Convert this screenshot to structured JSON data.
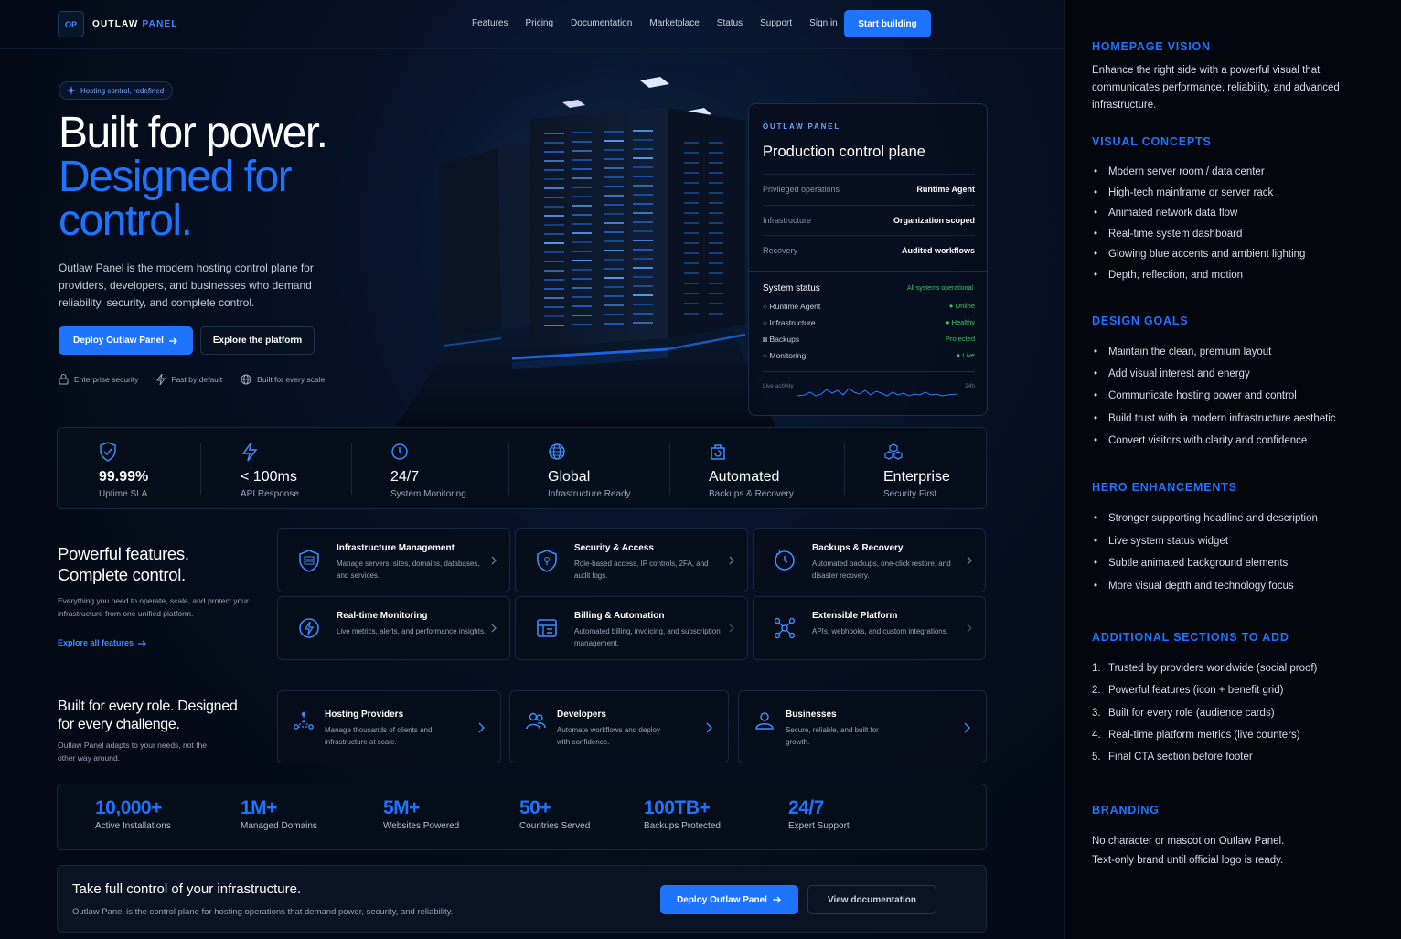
{
  "brand": {
    "logo_mark": "OP",
    "name_part1": "OUTLAW",
    "name_part2": "PANEL"
  },
  "nav": {
    "items": [
      "Features",
      "Pricing",
      "Documentation",
      "Marketplace",
      "Status",
      "Support",
      "Sign in"
    ],
    "cta": "Start building"
  },
  "hero": {
    "pill": "Hosting control, redefined",
    "title_line1": "Built for power.",
    "title_line2": "Designed for",
    "title_line3": "control.",
    "description": "Outlaw Panel is the modern hosting control plane for providers, developers, and businesses who demand reliability, security, and complete control.",
    "primary_button": "Deploy Outlaw Panel",
    "secondary_button": "Explore the platform",
    "trust": [
      "Enterprise security",
      "Fast by default",
      "Built for every scale"
    ]
  },
  "control_card": {
    "brand": "OUTLAW PANEL",
    "title": "Production control plane",
    "rows": [
      {
        "key": "Privileged operations",
        "value": "Runtime Agent"
      },
      {
        "key": "Infrastructure",
        "value": "Organization scoped"
      },
      {
        "key": "Recovery",
        "value": "Audited workflows"
      }
    ],
    "system_status_title": "System status",
    "system_status_summary": "All systems operational",
    "services": [
      {
        "name": "Runtime Agent",
        "status": "Online"
      },
      {
        "name": "Infrastructure",
        "status": "Healthy"
      },
      {
        "name": "Backups",
        "status": "Protected"
      },
      {
        "name": "Monitoring",
        "status": "Live"
      }
    ],
    "activity_label": "Live activity",
    "activity_range": "24h"
  },
  "stats": [
    {
      "icon": "shield-check-icon",
      "value": "99.99%",
      "label": "Uptime SLA"
    },
    {
      "icon": "bolt-icon",
      "value": "< 100ms",
      "label": "API Response"
    },
    {
      "icon": "clock-icon",
      "value": "24/7",
      "label": "System Monitoring"
    },
    {
      "icon": "globe-icon",
      "value": "Global",
      "label": "Infrastructure Ready"
    },
    {
      "icon": "backup-box-icon",
      "value": "Automated",
      "label": "Backups & Recovery"
    },
    {
      "icon": "cubes-icon",
      "value": "Enterprise",
      "label": "Security First"
    }
  ],
  "features": {
    "title_line1": "Powerful features.",
    "title_line2": "Complete control.",
    "description": "Everything you need to operate, scale, and protect your infrastructure from one unified platform.",
    "link": "Explore all features",
    "cards": [
      {
        "icon": "server-shield-icon",
        "title": "Infrastructure Management",
        "desc": "Manage servers, sites, domains, databases, and services."
      },
      {
        "icon": "shield-lock-icon",
        "title": "Security & Access",
        "desc": "Role-based access, IP controls, 2FA, and audit logs."
      },
      {
        "icon": "restore-icon",
        "title": "Backups & Recovery",
        "desc": "Automated backups, one-click restore, and disaster recovery."
      },
      {
        "icon": "pulse-icon",
        "title": "Real-time Monitoring",
        "desc": "Live metrics, alerts, and performance insights."
      },
      {
        "icon": "billing-icon",
        "title": "Billing & Automation",
        "desc": "Automated billing, invoicing, and subscription management."
      },
      {
        "icon": "plugin-icon",
        "title": "Extensible Platform",
        "desc": "APIs, webhooks, and custom integrations."
      }
    ]
  },
  "roles": {
    "title": "Built for every role. Designed for every challenge.",
    "description": "Outlaw Panel adapts to your needs, not the other way around.",
    "cards": [
      {
        "icon": "network-nodes-icon",
        "title": "Hosting Providers",
        "desc": "Manage thousands of clients and infrastructure at scale."
      },
      {
        "icon": "users-icon",
        "title": "Developers",
        "desc": "Automate workflows and deploy with confidence."
      },
      {
        "icon": "user-icon",
        "title": "Businesses",
        "desc": "Secure, reliable, and built for growth."
      }
    ]
  },
  "metrics": [
    {
      "value": "10,000+",
      "label": "Active Installations"
    },
    {
      "value": "1M+",
      "label": "Managed Domains"
    },
    {
      "value": "5M+",
      "label": "Websites Powered"
    },
    {
      "value": "50+",
      "label": "Countries Served"
    },
    {
      "value": "100TB+",
      "label": "Backups Protected"
    },
    {
      "value": "24/7",
      "label": "Expert Support"
    }
  ],
  "final_cta": {
    "title": "Take full control of your infrastructure.",
    "desc": "Outlaw Panel is the control plane for hosting operations that demand power, security, and reliability.",
    "primary": "Deploy Outlaw Panel",
    "secondary": "View documentation"
  },
  "notes": {
    "vision_title": "HOMEPAGE VISION",
    "vision_text": "Enhance the right side with a powerful visual that communicates performance, reliability, and advanced infrastructure.",
    "concepts_title": "VISUAL CONCEPTS",
    "concepts": [
      "Modern server room / data center",
      "High-tech mainframe or server rack",
      "Animated network data flow",
      "Real-time system dashboard",
      "Glowing blue accents and ambient lighting",
      "Depth, reflection, and motion"
    ],
    "goals_title": "DESIGN GOALS",
    "goals": [
      "Maintain the clean, premium layout",
      "Add visual interest and energy",
      "Communicate hosting power and control",
      "Build trust with ia modern infrastructure aesthetic",
      "Convert visitors with clarity and confidence"
    ],
    "hero_title": "HERO ENHANCEMENTS",
    "hero_items": [
      "Stronger supporting headline and description",
      "Live system status widget",
      "Subtle animated background elements",
      "More visual depth and technology focus"
    ],
    "sections_title": "ADDITIONAL SECTIONS TO ADD",
    "sections": [
      "Trusted by providers worldwide (social proof)",
      "Powerful features (icon + benefit grid)",
      "Built for every role (audience cards)",
      "Real-time platform metrics (live counters)",
      "Final CTA section before footer"
    ],
    "branding_title": "BRANDING",
    "branding_line1": "No character or mascot on Outlaw Panel.",
    "branding_line2": "Text-only brand until official logo is ready."
  },
  "colors": {
    "accent": "#1e74ff",
    "background": "#050a14",
    "status_ok": "#2ecc63"
  }
}
